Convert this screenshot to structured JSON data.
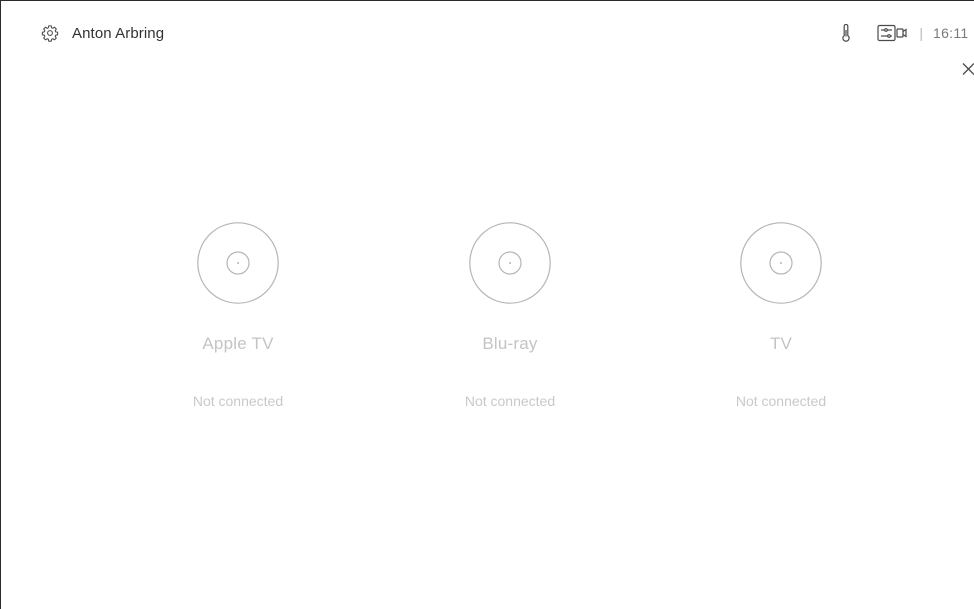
{
  "header": {
    "user_name": "Anton Arbring",
    "separator": "|",
    "time": "16:11",
    "icons": {
      "settings": "gear-icon",
      "temperature": "thermometer-icon",
      "camera_controls": "camera-controls-icon",
      "close": "close-icon"
    }
  },
  "devices": [
    {
      "name": "Apple TV",
      "status": "Not connected",
      "icon": "disc-icon"
    },
    {
      "name": "Blu-ray",
      "status": "Not connected",
      "icon": "disc-icon"
    },
    {
      "name": "TV",
      "status": "Not connected",
      "icon": "disc-icon"
    }
  ],
  "colors": {
    "text_primary": "#333333",
    "text_muted": "#c4c4c4",
    "icon_stroke": "#4a4a4a",
    "circle_stroke": "#b5b5b5"
  }
}
